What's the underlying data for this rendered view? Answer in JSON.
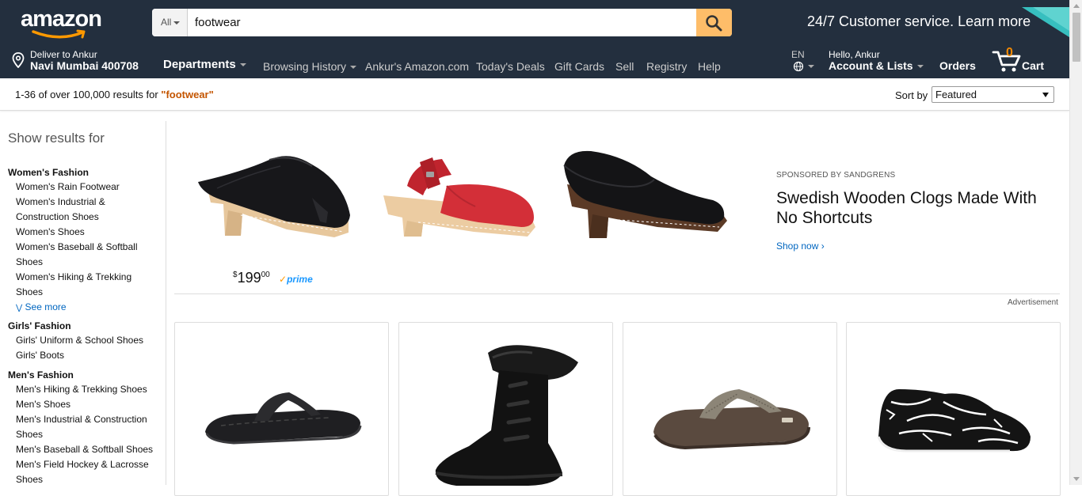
{
  "header": {
    "logo_text": "amazon",
    "search": {
      "category": "All",
      "value": "footwear"
    },
    "promo": "24/7 Customer service. Learn more",
    "deliver": {
      "line1": "Deliver to Ankur",
      "line2": "Navi Mumbai 400708"
    },
    "nav": {
      "departments": "Departments",
      "browsing_history": "Browsing History",
      "ankurs_amazon": "Ankur's Amazon.com",
      "todays_deals": "Today's Deals",
      "gift_cards": "Gift Cards",
      "sell": "Sell",
      "registry": "Registry",
      "help": "Help"
    },
    "lang": "EN",
    "account": {
      "greeting": "Hello, Ankur",
      "label": "Account & Lists"
    },
    "orders": "Orders",
    "cart": {
      "count": "0",
      "label": "Cart"
    }
  },
  "results": {
    "count_text": "1-36 of over 100,000 results for ",
    "query": "\"footwear\"",
    "sort_label": "Sort by",
    "sort_value": "Featured"
  },
  "sidebar": {
    "title": "Show results for",
    "groups": [
      {
        "heading": "Women's Fashion",
        "items": [
          "Women's Rain Footwear",
          "Women's Industrial &",
          "Construction Shoes",
          "Women's Shoes",
          "Women's Baseball & Softball",
          "Shoes",
          "Women's Hiking & Trekking",
          "Shoes"
        ]
      },
      {
        "heading": "Girls' Fashion",
        "items": [
          "Girls' Uniform & School Shoes",
          "Girls' Boots"
        ]
      },
      {
        "heading": "Men's Fashion",
        "items": [
          "Men's Hiking & Trekking Shoes",
          "Men's Shoes",
          "Men's Industrial & Construction",
          "Shoes",
          "Men's Baseball & Softball Shoes",
          "Men's Field Hockey & Lacrosse",
          "Shoes"
        ]
      }
    ],
    "see_more": "See more"
  },
  "ad": {
    "price_symbol": "$",
    "price_whole": "199",
    "price_fraction": "00",
    "prime": "prime",
    "sponsored": "SPONSORED BY SANDGRENS",
    "title": "Swedish Wooden Clogs Made With No Shortcuts",
    "shop_now": "Shop now ›",
    "advertisement": "Advertisement"
  },
  "colors": {
    "nav_bg": "#232f3e",
    "search_button": "#febd69",
    "query_orange": "#c45500",
    "link_blue": "#0066c0",
    "cart_orange": "#f08804"
  }
}
